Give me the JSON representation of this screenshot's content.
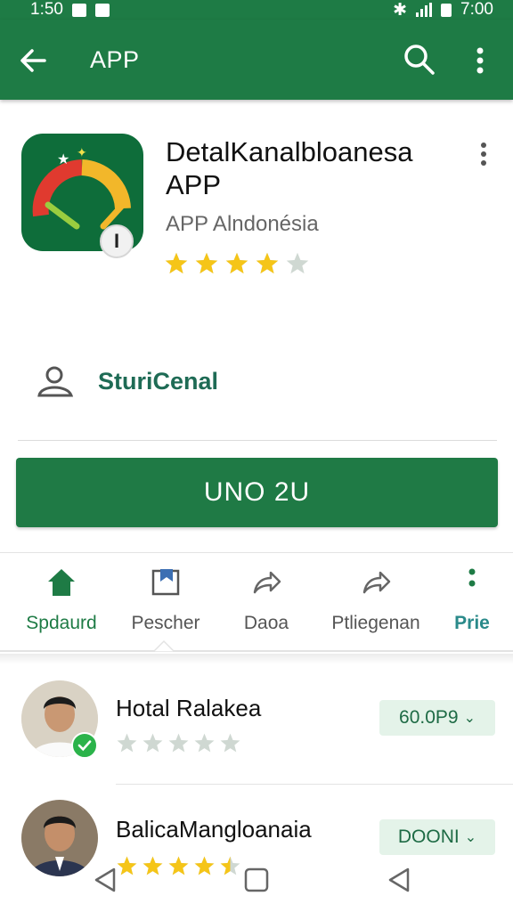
{
  "status_bar": {
    "time_left": "1:50",
    "time_right": "7:00"
  },
  "app_bar": {
    "title": "APP"
  },
  "app": {
    "name": "DetalKanalbloanesa APP",
    "developer": "APP Alndonésia",
    "icon_badge": "I",
    "rating": 4
  },
  "stat": {
    "label": "SturiCenal"
  },
  "install_button": {
    "label": "UNO 2U"
  },
  "tabs": [
    {
      "label": "Spdaurd",
      "icon": "home-icon",
      "active": true
    },
    {
      "label": "Pescher",
      "icon": "bookmark-icon",
      "active": false
    },
    {
      "label": "Daoa",
      "icon": "share-icon",
      "active": false
    },
    {
      "label": "Ptliegenan",
      "icon": "share-icon",
      "active": false
    },
    {
      "label": "Prie",
      "icon": "more-vertical-icon",
      "active": false
    }
  ],
  "reviews": [
    {
      "name": "Hotal Ralakea",
      "rating": 0,
      "chip": "60.0P9",
      "verified": true
    },
    {
      "name": "BalicaMangloanaia",
      "rating": 4.5,
      "chip": "DOONI",
      "verified": false
    }
  ],
  "colors": {
    "primary": "#1e7b45",
    "chip_bg": "#e4f3e9",
    "star": "#f5c518",
    "star_empty": "#cfd8d2"
  }
}
